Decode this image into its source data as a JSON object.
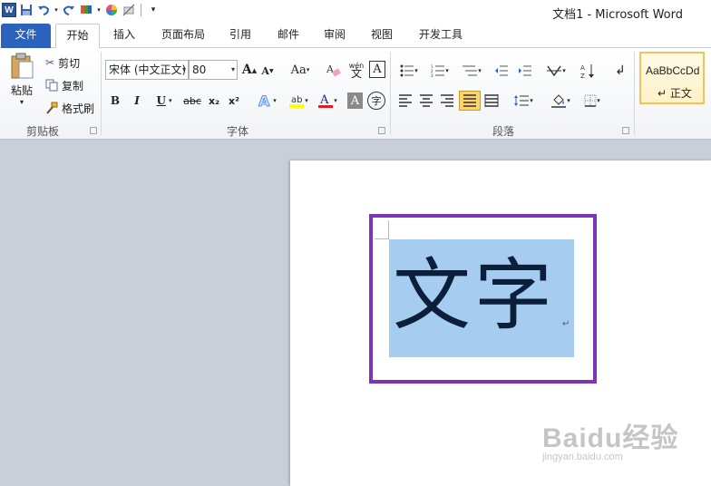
{
  "window": {
    "title": "文档1  -  Microsoft Word",
    "logo_letter": "W"
  },
  "quick_access": {
    "items": [
      "word-logo-icon",
      "save-icon",
      "undo-icon",
      "redo-icon",
      "format-painter-icon",
      "color-wheel-icon",
      "clear-icon",
      "customize-icon"
    ]
  },
  "tabs": [
    "文件",
    "开始",
    "插入",
    "页面布局",
    "引用",
    "邮件",
    "审阅",
    "视图",
    "开发工具"
  ],
  "ribbon": {
    "clipboard": {
      "paste": "粘贴",
      "cut": "剪切",
      "copy": "复制",
      "format_painter": "格式刷",
      "label": "剪贴板"
    },
    "font": {
      "font_name": "宋体 (中文正文)",
      "font_size": "80",
      "bold": "B",
      "italic": "I",
      "underline": "U",
      "strikethrough": "abc",
      "subscript": "x₂",
      "superscript": "x²",
      "change_case": "Aa",
      "grow": "A",
      "shrink": "A",
      "char_shading": "A",
      "font_color_letter": "A",
      "enclose_char": "字",
      "phonetic": "wén",
      "label": "字体"
    },
    "paragraph": {
      "label": "段落"
    },
    "styles": {
      "sample": "AaBbCcDd",
      "normal": "↵ 正文"
    }
  },
  "document": {
    "text": "文字",
    "paragraph_mark": "↵",
    "highlight_color": "#a6cdf0",
    "frame_color": "#7b35b8"
  },
  "watermark": {
    "brand": "Baidu经验",
    "url": "jingyan.baidu.com"
  },
  "colors": {
    "file_tab": "#2a62bd",
    "underline_color": "#e02020",
    "highlight_yellow": "#ffff00"
  }
}
